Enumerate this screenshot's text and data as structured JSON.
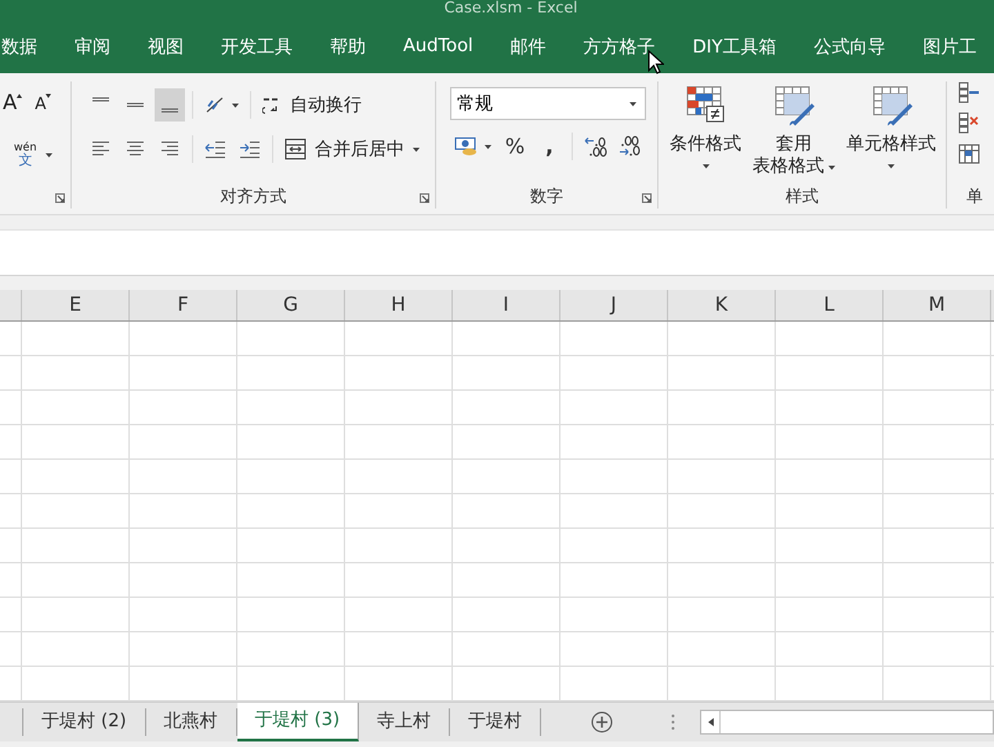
{
  "window": {
    "title": "Case.xlsm  -  Excel"
  },
  "ribbon_tabs": [
    {
      "label": "数据",
      "selected": false
    },
    {
      "label": "审阅",
      "selected": false
    },
    {
      "label": "视图",
      "selected": false
    },
    {
      "label": "开发工具",
      "selected": false
    },
    {
      "label": "帮助",
      "selected": false
    },
    {
      "label": "AudTool",
      "selected": false
    },
    {
      "label": "邮件",
      "selected": false
    },
    {
      "label": "方方格子",
      "selected": false
    },
    {
      "label": "DIY工具箱",
      "selected": false
    },
    {
      "label": "公式向导",
      "selected": false
    },
    {
      "label": "图片工",
      "selected": false
    }
  ],
  "font_group": {
    "grow_font": "A",
    "shrink_font": "A",
    "phonetic_top": "wén",
    "phonetic_char": "文"
  },
  "alignment_group": {
    "label": "对齐方式",
    "vertical_align": [
      {
        "selected": false
      },
      {
        "selected": false
      },
      {
        "selected": true
      }
    ],
    "wrap_text": "自动换行",
    "merge_center": "合并后居中"
  },
  "number_group": {
    "label": "数字",
    "format": "常规",
    "percent": "%",
    "comma": ","
  },
  "styles_group": {
    "label": "样式",
    "buttons": [
      {
        "kind": "conditional",
        "lines": [
          "条件格式"
        ]
      },
      {
        "kind": "table",
        "lines": [
          "套用",
          "表格格式"
        ]
      },
      {
        "kind": "cell",
        "lines": [
          "单元格样式"
        ]
      }
    ]
  },
  "cells_group": {
    "label": "单"
  },
  "columns": [
    "E",
    "F",
    "G",
    "H",
    "I",
    "J",
    "K",
    "L",
    "M"
  ],
  "sheet_tabs": [
    {
      "label": "于堤村 (2)",
      "selected": false
    },
    {
      "label": "北燕村",
      "selected": false
    },
    {
      "label": "于堤村 (3)",
      "selected": true
    },
    {
      "label": "寺上村",
      "selected": false
    },
    {
      "label": "于堤村",
      "selected": false
    }
  ]
}
